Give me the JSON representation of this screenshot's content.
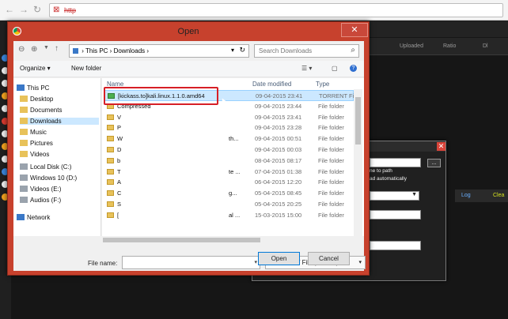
{
  "browser": {
    "back_icon": "arrow-left-icon",
    "forward_icon": "arrow-right-icon",
    "url_text": "http"
  },
  "background_app": {
    "columns": [
      "Uploaded",
      "Ratio",
      "Dl"
    ],
    "dialog_text_1": "ne to path",
    "dialog_text_2": "ad automatically",
    "log_tab": "Log",
    "clear_tab": "Clea",
    "dots_button": "..."
  },
  "dialog": {
    "title": "Open",
    "close_symbol": "✕",
    "address": {
      "parts": [
        "This PC",
        "Downloads"
      ]
    },
    "search_placeholder": "Search Downloads",
    "toolbar": {
      "organize": "Organize ▾",
      "new_folder": "New folder"
    },
    "nav": {
      "items": [
        {
          "label": "This PC",
          "icon": "pc-icon"
        },
        {
          "label": "Desktop",
          "icon": "folder-icon"
        },
        {
          "label": "Documents",
          "icon": "folder-icon"
        },
        {
          "label": "Downloads",
          "icon": "folder-icon"
        },
        {
          "label": "Music",
          "icon": "folder-icon"
        },
        {
          "label": "Pictures",
          "icon": "folder-icon"
        },
        {
          "label": "Videos",
          "icon": "folder-icon"
        },
        {
          "label": "Local Disk (C:)",
          "icon": "drive-icon"
        },
        {
          "label": "Windows 10 (D:)",
          "icon": "drive-icon"
        },
        {
          "label": "Videos (E:)",
          "icon": "drive-icon"
        },
        {
          "label": "Audios (F:)",
          "icon": "drive-icon"
        },
        {
          "label": "Network",
          "icon": "network-icon"
        }
      ]
    },
    "columns": {
      "name": "Name",
      "date": "Date modified",
      "type": "Type"
    },
    "files": [
      {
        "name": "[kickass.to]kali.linux.1.1.0.amd64",
        "trail": "",
        "date": "09-04-2015 23:41",
        "type": "TORRENT File",
        "selected": true
      },
      {
        "name": "Compressed",
        "trail": "",
        "date": "09-04-2015 23:44",
        "type": "File folder"
      },
      {
        "name": "V",
        "trail": "",
        "date": "09-04-2015 23:41",
        "type": "File folder"
      },
      {
        "name": "P",
        "trail": "",
        "date": "09-04-2015 23:28",
        "type": "File folder"
      },
      {
        "name": "W",
        "trail": "th...",
        "date": "09-04-2015 00:51",
        "type": "File folder"
      },
      {
        "name": "D",
        "trail": "",
        "date": "09-04-2015 00:03",
        "type": "File folder"
      },
      {
        "name": "b",
        "trail": "",
        "date": "08-04-2015 08:17",
        "type": "File folder"
      },
      {
        "name": "T",
        "trail": "te ...",
        "date": "07-04-2015 01:38",
        "type": "File folder"
      },
      {
        "name": "A",
        "trail": "",
        "date": "06-04-2015 12:20",
        "type": "File folder"
      },
      {
        "name": "C",
        "trail": "g...",
        "date": "05-04-2015 08:45",
        "type": "File folder"
      },
      {
        "name": "S",
        "trail": "",
        "date": "05-04-2015 20:25",
        "type": "File folder"
      },
      {
        "name": "[",
        "trail": "al ...",
        "date": "15-03-2015 15:00",
        "type": "File folder"
      }
    ],
    "filename_label": "File name:",
    "filename_value": "",
    "filetype_value": "TORRENT File (.torrent)",
    "open_button": "Open",
    "cancel_button": "Cancel"
  }
}
